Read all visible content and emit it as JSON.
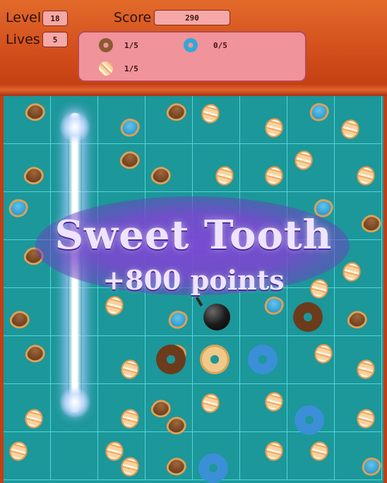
{
  "hud": {
    "level_label": "Level",
    "level_value": "18",
    "lives_label": "Lives",
    "lives_value": "5",
    "score_label": "Score",
    "score_value": "290",
    "goals": [
      {
        "icon": "plain-donut-icon",
        "progress": "1/5"
      },
      {
        "icon": "blue-donut-icon",
        "progress": "0/5"
      },
      {
        "icon": "striped-candy-icon",
        "progress": "1/5"
      }
    ]
  },
  "popup": {
    "title": "Sweet Tooth",
    "points": "+800 points"
  },
  "colors": {
    "board": "#1e9a9e",
    "grid_line": "#4fd6dc",
    "hud_background": "#d24e1c",
    "popup_glow": "#7a4ad2"
  },
  "board_size": {
    "columns": 8,
    "rows": 8
  }
}
